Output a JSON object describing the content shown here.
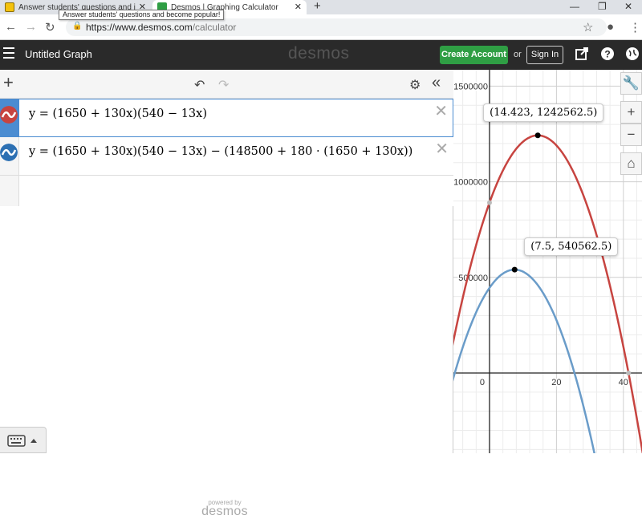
{
  "browser": {
    "tabs": [
      {
        "title": "Answer students' questions and i",
        "active": false
      },
      {
        "title": "Desmos | Graphing Calculator",
        "active": true
      }
    ],
    "tooltip": "Answer students' questions and become popular!",
    "url_host": "https://www.desmos.com",
    "url_path": "/calculator"
  },
  "header": {
    "title": "Untitled Graph",
    "logo": "desmos",
    "create_account": "Create Account",
    "or": "or",
    "sign_in": "Sign In",
    "icons": [
      "share-icon",
      "help-icon",
      "globe-icon"
    ]
  },
  "expressions": [
    {
      "latex": "y = (1650 + 130x)(540 − 13x)",
      "color": "#c74440"
    },
    {
      "latex": "y = (1650 + 130x)(540 − 13x) − (148500 + 180 · (1650 + 130x))",
      "color": "#2d70b3"
    }
  ],
  "graph": {
    "y_ticks": [
      "1500000",
      "1000000",
      "500000"
    ],
    "x_ticks": [
      "0",
      "20",
      "40"
    ],
    "points": [
      {
        "label": "(14.423, 1242562.5)",
        "x": 14.423,
        "y": 1242562.5,
        "curve": "red"
      },
      {
        "label": "(7.5, 540562.5)",
        "x": 7.5,
        "y": 540562.5,
        "curve": "blue"
      }
    ],
    "colors": {
      "red": "#c74440",
      "blue": "#6a9cc9",
      "grid_minor": "#ececec",
      "grid_major": "#cfcfcf",
      "axis": "#222222"
    }
  },
  "footer": {
    "powered_by": "powered by",
    "brand": "desmos"
  }
}
